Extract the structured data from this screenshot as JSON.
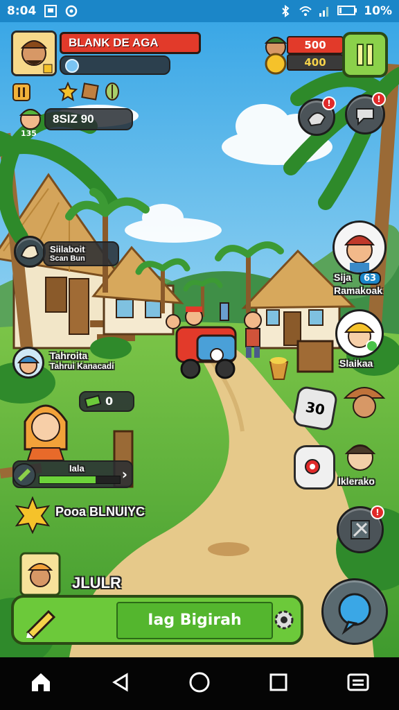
{
  "status_bar": {
    "time": "8:04",
    "battery": "10%"
  },
  "player": {
    "name": "BLANK DE AGA",
    "currency_label": "8SIZ 90",
    "currency_sub": "135"
  },
  "resources": {
    "coins": "500",
    "gems": "400"
  },
  "npcs": [
    {
      "title": "Siilaboit",
      "subtitle": "Scan Bun"
    },
    {
      "title": "Tahroita",
      "subtitle": "Tahrui Kanacadi"
    },
    {
      "title": "Sija",
      "subtitle": "Ramakoak",
      "badge": "63"
    },
    {
      "title": "Slaikaa"
    },
    {
      "title": "Iklerako"
    }
  ],
  "quest_panel": {
    "counter": "0",
    "progress_label": "Iala",
    "progress": 0.7
  },
  "event_label": "Pooa BLNUIYC",
  "bottom": {
    "player_tag": "JLULR",
    "action_label": "Iag Bigirah"
  },
  "rock_badge": "30",
  "colors": {
    "accent_red": "#e23a2a",
    "accent_green": "#6cc93a",
    "sky": "#5bb8e6",
    "status_bar": "#1b86c8"
  }
}
